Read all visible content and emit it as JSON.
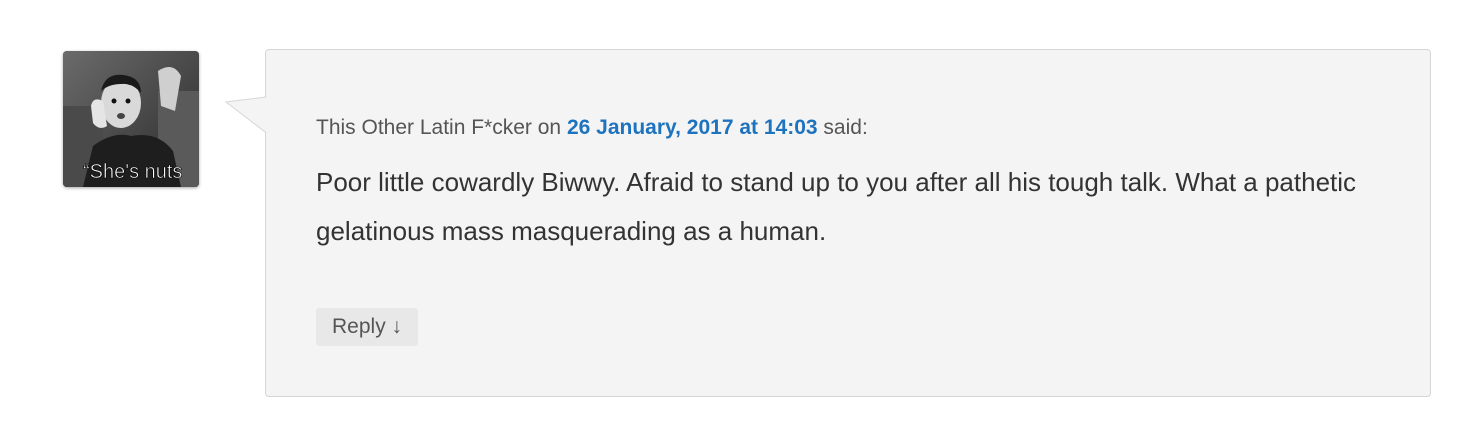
{
  "comment": {
    "author": "This Other Latin F*cker",
    "on_text": "on",
    "date": "26 January, 2017 at 14:03",
    "said_text": "said:",
    "text": "Poor little cowardly Biwwy. Afraid to stand up to you after all his tough talk. What a pathetic gelatinous mass masquerading as a human.",
    "reply_label": "Reply",
    "reply_arrow": "↓",
    "avatar_caption": "“She's nuts"
  },
  "colors": {
    "link": "#1e73be",
    "bubble_bg": "#f4f4f4",
    "bubble_border": "#d6d6d6",
    "text": "#333333",
    "meta": "#555555",
    "reply_bg": "#e8e8e8"
  }
}
